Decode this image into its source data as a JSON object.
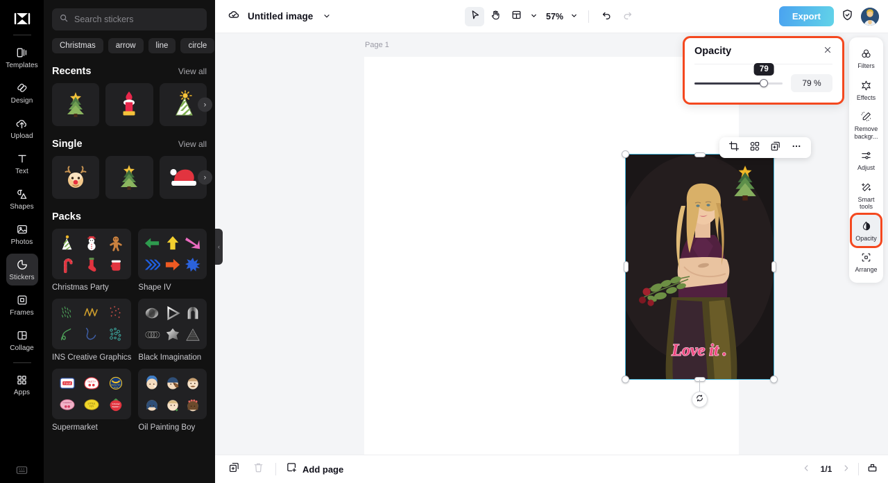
{
  "app": {
    "logo_icon": "capcut-logo-icon"
  },
  "left_rail": {
    "items": [
      {
        "label": "Templates",
        "icon": "templates-icon",
        "active": false
      },
      {
        "label": "Design",
        "icon": "design-icon",
        "active": false
      },
      {
        "label": "Upload",
        "icon": "upload-cloud-icon",
        "active": false
      },
      {
        "label": "Text",
        "icon": "text-icon",
        "active": false
      },
      {
        "label": "Shapes",
        "icon": "shapes-icon",
        "active": false
      },
      {
        "label": "Photos",
        "icon": "photos-icon",
        "active": false
      },
      {
        "label": "Stickers",
        "icon": "stickers-icon",
        "active": true
      },
      {
        "label": "Frames",
        "icon": "frames-icon",
        "active": false
      },
      {
        "label": "Collage",
        "icon": "collage-icon",
        "active": false
      },
      {
        "label": "Apps",
        "icon": "apps-grid-icon",
        "active": false
      }
    ],
    "bottom_icon": "keyboard-shortcuts-icon"
  },
  "sticker_panel": {
    "search": {
      "placeholder": "Search stickers",
      "value": "",
      "icon": "search-icon"
    },
    "chips": [
      "Christmas",
      "arrow",
      "line",
      "circle"
    ],
    "sections": [
      {
        "title": "Recents",
        "view_all": "View all",
        "stickers": [
          "christmas-tree",
          "candle",
          "party-hat"
        ]
      },
      {
        "title": "Single",
        "view_all": "View all",
        "stickers": [
          "reindeer",
          "christmas-tree",
          "santa-hat"
        ]
      }
    ],
    "packs_title": "Packs",
    "packs": [
      {
        "name": "Christmas Party"
      },
      {
        "name": "Shape IV"
      },
      {
        "name": "INS Creative Graphics"
      },
      {
        "name": "Black Imagination"
      },
      {
        "name": "Supermarket"
      },
      {
        "name": "Oil Painting Boy"
      }
    ],
    "collapse_icon": "chevron-left-icon",
    "next_icon": "chevron-right-icon"
  },
  "topbar": {
    "cloud_icon": "cloud-sync-icon",
    "doc_title": "Untitled image",
    "doc_caret": "chevron-down-icon",
    "tools": [
      {
        "name": "select-tool",
        "icon": "cursor-arrow-icon",
        "selected": true
      },
      {
        "name": "hand-tool",
        "icon": "hand-icon",
        "selected": false
      },
      {
        "name": "layout-tool",
        "icon": "layout-icon",
        "selected": false
      }
    ],
    "zoom_level": "57%",
    "undo_icon": "undo-icon",
    "redo_icon": "redo-icon",
    "export_label": "Export",
    "shield_icon": "shield-check-icon",
    "avatar": "user-avatar"
  },
  "canvas": {
    "page_label": "Page 1",
    "image_text": "Love it .",
    "float_toolbar": [
      {
        "name": "crop-button",
        "icon": "crop-icon"
      },
      {
        "name": "cutout-button",
        "icon": "cutout-icon"
      },
      {
        "name": "duplicate-button",
        "icon": "duplicate-icon"
      },
      {
        "name": "more-button",
        "icon": "ellipsis-icon"
      }
    ],
    "rotate_icon": "rotate-icon"
  },
  "opacity_panel": {
    "title": "Opacity",
    "close_icon": "close-icon",
    "slider_value": 79,
    "tooltip": "79",
    "value_label": "79 %"
  },
  "right_rail": {
    "items": [
      {
        "label": "Filters",
        "icon": "filters-icon",
        "active": false,
        "highlighted": false
      },
      {
        "label": "Effects",
        "icon": "effects-icon",
        "active": false,
        "highlighted": false
      },
      {
        "label": "Remove backgr...",
        "icon": "remove-background-icon",
        "active": false,
        "highlighted": false
      },
      {
        "label": "Adjust",
        "icon": "adjust-sliders-icon",
        "active": false,
        "highlighted": false
      },
      {
        "label": "Smart tools",
        "icon": "smart-tools-icon",
        "active": false,
        "highlighted": false
      },
      {
        "label": "Opacity",
        "icon": "opacity-drop-icon",
        "active": true,
        "highlighted": true
      },
      {
        "label": "Arrange",
        "icon": "arrange-icon",
        "active": false,
        "highlighted": false
      }
    ]
  },
  "bottombar": {
    "duplicate_page_icon": "duplicate-page-icon",
    "delete_page_icon": "trash-icon",
    "add_page_icon": "add-page-icon",
    "add_page_label": "Add page",
    "prev_icon": "chevron-left-icon",
    "page_indicator": "1/1",
    "next_icon": "chevron-right-icon",
    "export_bottom_icon": "export-tray-icon"
  },
  "colors": {
    "accent_highlight": "#f4481f",
    "export_gradient_start": "#4aa3f0",
    "export_gradient_end": "#62d3e8",
    "selection_outline": "#43b6dd",
    "rail_background": "#000000",
    "panel_background": "#121212"
  }
}
